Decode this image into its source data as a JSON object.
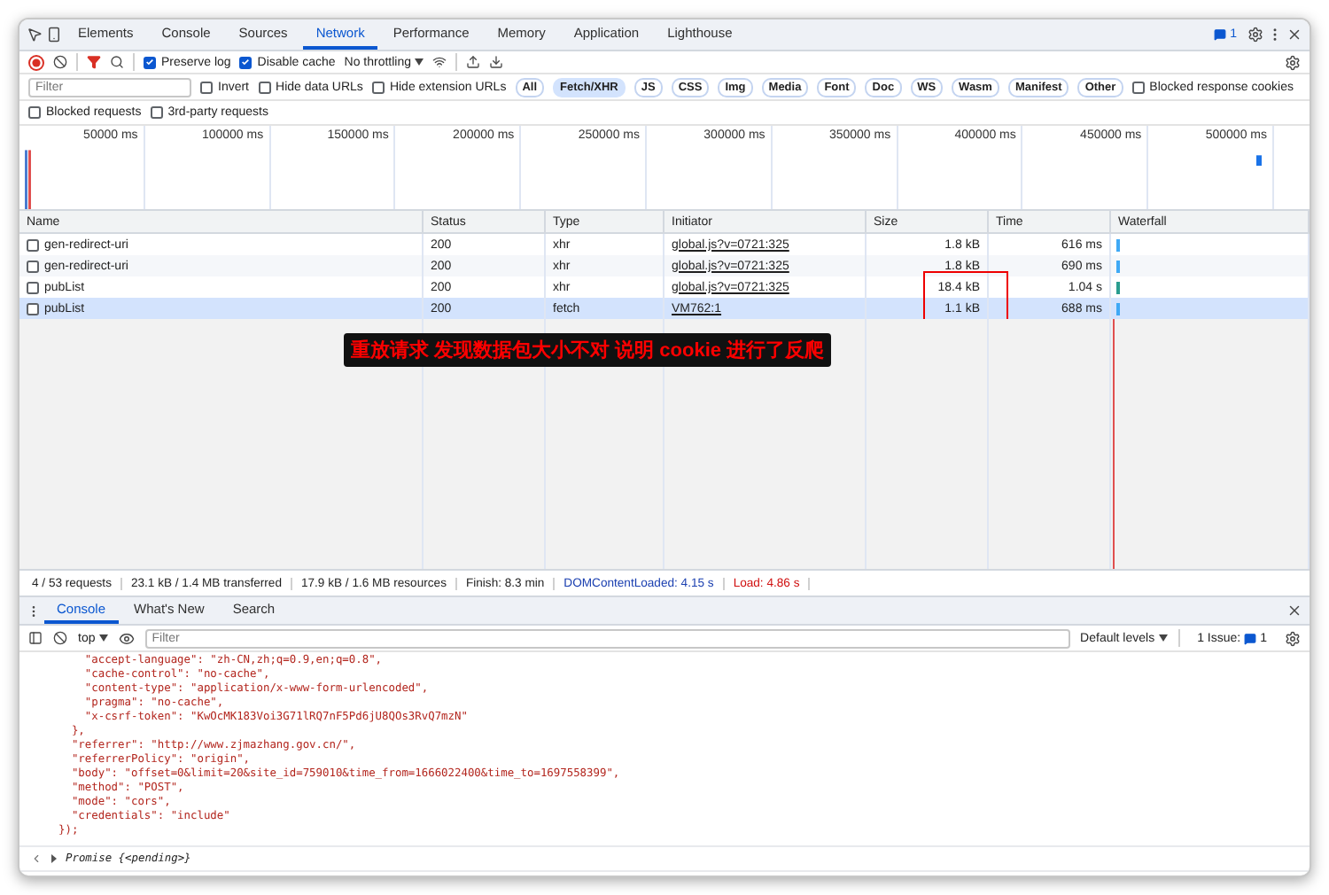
{
  "main_tabs": [
    {
      "label": "Elements",
      "selected": false
    },
    {
      "label": "Console",
      "selected": false
    },
    {
      "label": "Sources",
      "selected": false
    },
    {
      "label": "Network",
      "selected": true
    },
    {
      "label": "Performance",
      "selected": false
    },
    {
      "label": "Memory",
      "selected": false
    },
    {
      "label": "Application",
      "selected": false
    },
    {
      "label": "Lighthouse",
      "selected": false
    }
  ],
  "issues_count": "1",
  "toolbar": {
    "recording": true,
    "filter_active": true,
    "options": [
      {
        "label": "Preserve log",
        "checked": true
      },
      {
        "label": "Disable cache",
        "checked": true
      }
    ],
    "throttling": "No throttling"
  },
  "filter": {
    "placeholder": "Filter",
    "options": [
      {
        "label": "Invert",
        "checked": false
      },
      {
        "label": "Hide data URLs",
        "checked": false
      },
      {
        "label": "Hide extension URLs",
        "checked": false
      }
    ],
    "types": [
      {
        "label": "All",
        "selected": false
      },
      {
        "label": "Fetch/XHR",
        "selected": true
      },
      {
        "label": "JS",
        "selected": false
      },
      {
        "label": "CSS",
        "selected": false
      },
      {
        "label": "Img",
        "selected": false
      },
      {
        "label": "Media",
        "selected": false
      },
      {
        "label": "Font",
        "selected": false
      },
      {
        "label": "Doc",
        "selected": false
      },
      {
        "label": "WS",
        "selected": false
      },
      {
        "label": "Wasm",
        "selected": false
      },
      {
        "label": "Manifest",
        "selected": false
      },
      {
        "label": "Other",
        "selected": false
      }
    ],
    "extra_options": [
      {
        "label": "Blocked response cookies",
        "checked": false
      },
      {
        "label": "Blocked requests",
        "checked": false
      },
      {
        "label": "3rd-party requests",
        "checked": false
      }
    ]
  },
  "timeline_ticks": [
    "50000 ms",
    "100000 ms",
    "150000 ms",
    "200000 ms",
    "250000 ms",
    "300000 ms",
    "350000 ms",
    "400000 ms",
    "450000 ms",
    "500000 ms"
  ],
  "table": {
    "columns": [
      "Name",
      "Status",
      "Type",
      "Initiator",
      "Size",
      "Time",
      "Waterfall"
    ],
    "rows": [
      {
        "name": "gen-redirect-uri",
        "status": "200",
        "type": "xhr",
        "initiator": "global.js?v=0721:325",
        "size": "1.8 kB",
        "time": "616 ms",
        "selected": false,
        "highlighted": false
      },
      {
        "name": "gen-redirect-uri",
        "status": "200",
        "type": "xhr",
        "initiator": "global.js?v=0721:325",
        "size": "1.8 kB",
        "time": "690 ms",
        "selected": false,
        "highlighted": false
      },
      {
        "name": "pubList",
        "status": "200",
        "type": "xhr",
        "initiator": "global.js?v=0721:325",
        "size": "18.4 kB",
        "time": "1.04 s",
        "selected": false,
        "highlighted": true
      },
      {
        "name": "pubList",
        "status": "200",
        "type": "fetch",
        "initiator": "VM762:1",
        "size": "1.1 kB",
        "time": "688 ms",
        "selected": true,
        "highlighted": true
      }
    ]
  },
  "annotation": "重放请求 发现数据包大小不对 说明 cookie 进行了反爬",
  "status_bar": [
    {
      "text": "4 / 53 requests",
      "kind": "plain"
    },
    {
      "text": "23.1 kB / 1.4 MB transferred",
      "kind": "plain"
    },
    {
      "text": "17.9 kB / 1.6 MB resources",
      "kind": "plain"
    },
    {
      "text": "Finish: 8.3 min",
      "kind": "plain"
    },
    {
      "text": "DOMContentLoaded: 4.15 s",
      "kind": "dom"
    },
    {
      "text": "Load: 4.86 s",
      "kind": "load"
    }
  ],
  "drawer_tabs": [
    {
      "label": "Console",
      "selected": true
    },
    {
      "label": "What's New",
      "selected": false
    },
    {
      "label": "Search",
      "selected": false
    }
  ],
  "console_toolbar": {
    "context": "top",
    "filter_placeholder": "Filter",
    "levels": "Default levels",
    "issues_label": "1 Issue:",
    "issues_count": "1"
  },
  "console_lines": [
    "    \"accept-language\": \"zh-CN,zh;q=0.9,en;q=0.8\",",
    "    \"cache-control\": \"no-cache\",",
    "    \"content-type\": \"application/x-www-form-urlencoded\",",
    "    \"pragma\": \"no-cache\",",
    "    \"x-csrf-token\": \"KwOcMK183Voi3G71lRQ7nF5Pd6jU8QOs3RvQ7mzN\"",
    "  },",
    "  \"referrer\": \"http://www.zjmazhang.gov.cn/\",",
    "  \"referrerPolicy\": \"origin\",",
    "  \"body\": \"offset=0&limit=20&site_id=759010&time_from=1666022400&time_to=1697558399\",",
    "  \"method\": \"POST\",",
    "  \"mode\": \"cors\",",
    "  \"credentials\": \"include\"",
    "});"
  ],
  "console_result": "Promise {<pending>}"
}
